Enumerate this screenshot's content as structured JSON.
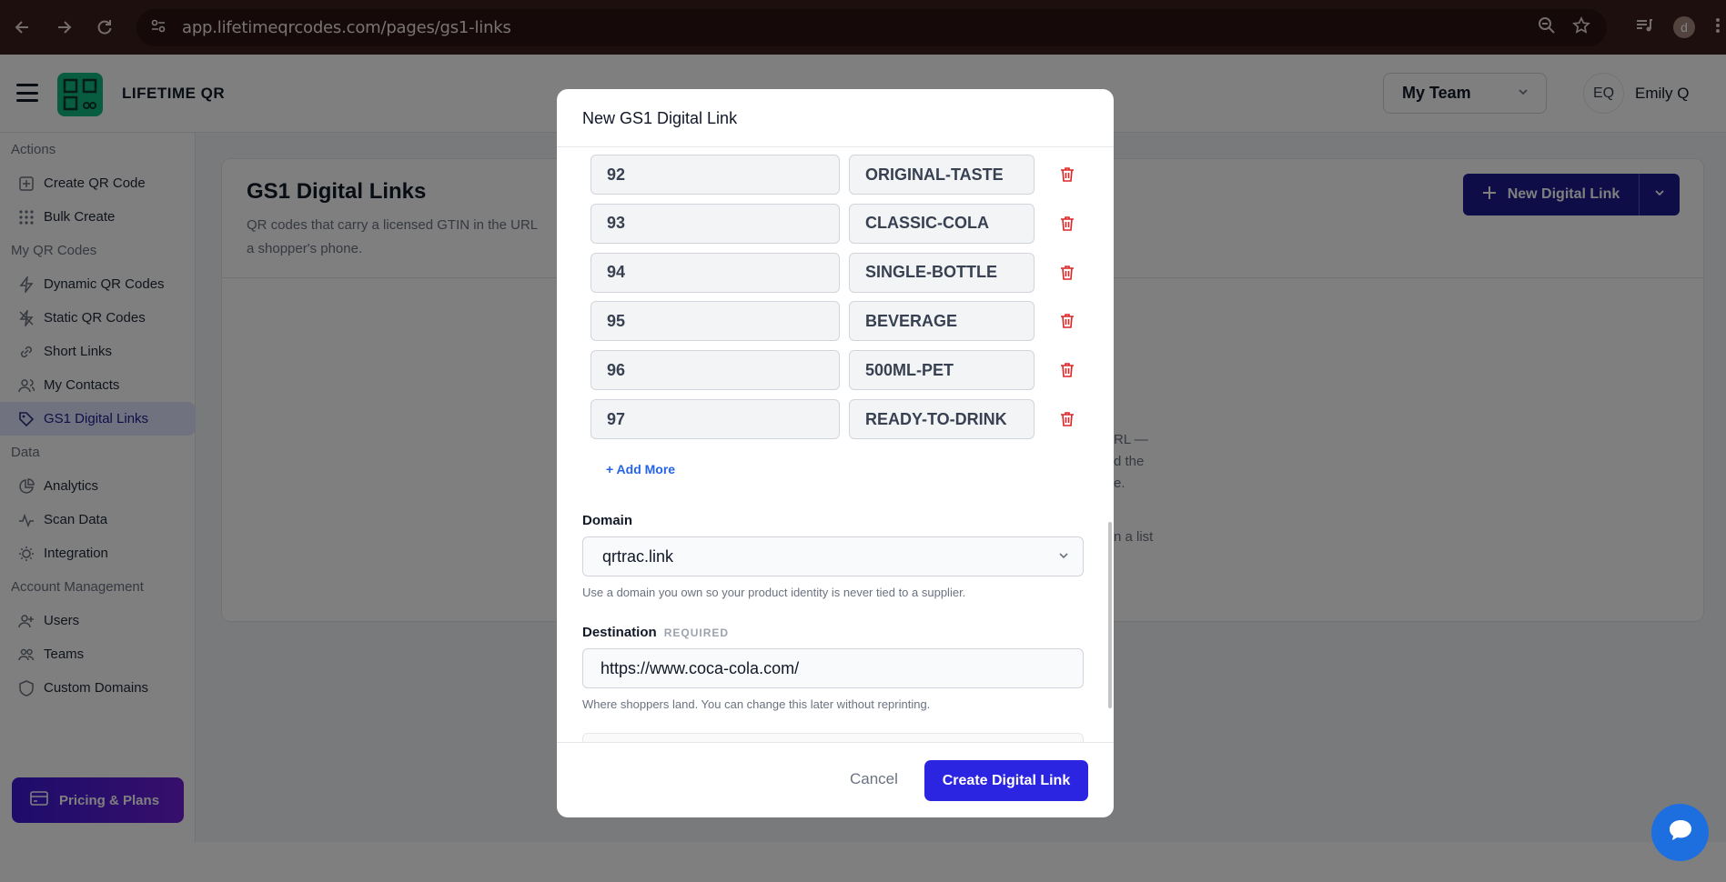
{
  "browser": {
    "url": "app.lifetimeqrcodes.com/pages/gs1-links",
    "profile_initial": "d"
  },
  "app": {
    "brand": "LIFETIME QR",
    "team_selector": "My Team",
    "user_initials": "EQ",
    "user_name": "Emily Q"
  },
  "sidebar": {
    "sections": [
      {
        "title": "Actions",
        "items": [
          {
            "label": "Create QR Code",
            "icon": "plus-square-icon"
          },
          {
            "label": "Bulk Create",
            "icon": "grid-icon"
          }
        ]
      },
      {
        "title": "My QR Codes",
        "items": [
          {
            "label": "Dynamic QR Codes",
            "icon": "bolt-icon"
          },
          {
            "label": "Static QR Codes",
            "icon": "bolt-off-icon"
          },
          {
            "label": "Short Links",
            "icon": "link-icon"
          },
          {
            "label": "My Contacts",
            "icon": "contacts-icon"
          },
          {
            "label": "GS1 Digital Links",
            "icon": "tag-icon"
          }
        ]
      },
      {
        "title": "Data",
        "items": [
          {
            "label": "Analytics",
            "icon": "pie-chart-icon"
          },
          {
            "label": "Scan Data",
            "icon": "activity-icon"
          },
          {
            "label": "Integration",
            "icon": "bulb-icon"
          }
        ]
      },
      {
        "title": "Account Management",
        "items": [
          {
            "label": "Users",
            "icon": "user-plus-icon"
          },
          {
            "label": "Teams",
            "icon": "team-icon"
          },
          {
            "label": "Custom Domains",
            "icon": "shield-icon"
          }
        ]
      }
    ],
    "pricing_label": "Pricing & Plans"
  },
  "page": {
    "title": "GS1 Digital Links",
    "description_line1": "QR codes that carry a licensed GTIN in the URL",
    "description_line2": "a shopper's phone.",
    "new_button": "New Digital Link",
    "fragments": [
      "RL —",
      "d the",
      "e.",
      "n a list"
    ]
  },
  "modal": {
    "title": "New GS1 Digital Link",
    "rows": [
      {
        "key": "92",
        "value": "ORIGINAL-TASTE"
      },
      {
        "key": "93",
        "value": "CLASSIC-COLA"
      },
      {
        "key": "94",
        "value": "SINGLE-BOTTLE"
      },
      {
        "key": "95",
        "value": "BEVERAGE"
      },
      {
        "key": "96",
        "value": "500ML-PET"
      },
      {
        "key": "97",
        "value": "READY-TO-DRINK"
      }
    ],
    "add_more": "+ Add More",
    "domain_label": "Domain",
    "domain_value": "qrtrac.link",
    "domain_help": "Use a domain you own so your product identity is never tied to a supplier.",
    "destination_label": "Destination",
    "destination_required": "REQUIRED",
    "destination_value": "https://www.coca-cola.com/",
    "destination_help": "Where shoppers land. You can change this later without reprinting.",
    "cancel": "Cancel",
    "create": "Create Digital Link"
  }
}
